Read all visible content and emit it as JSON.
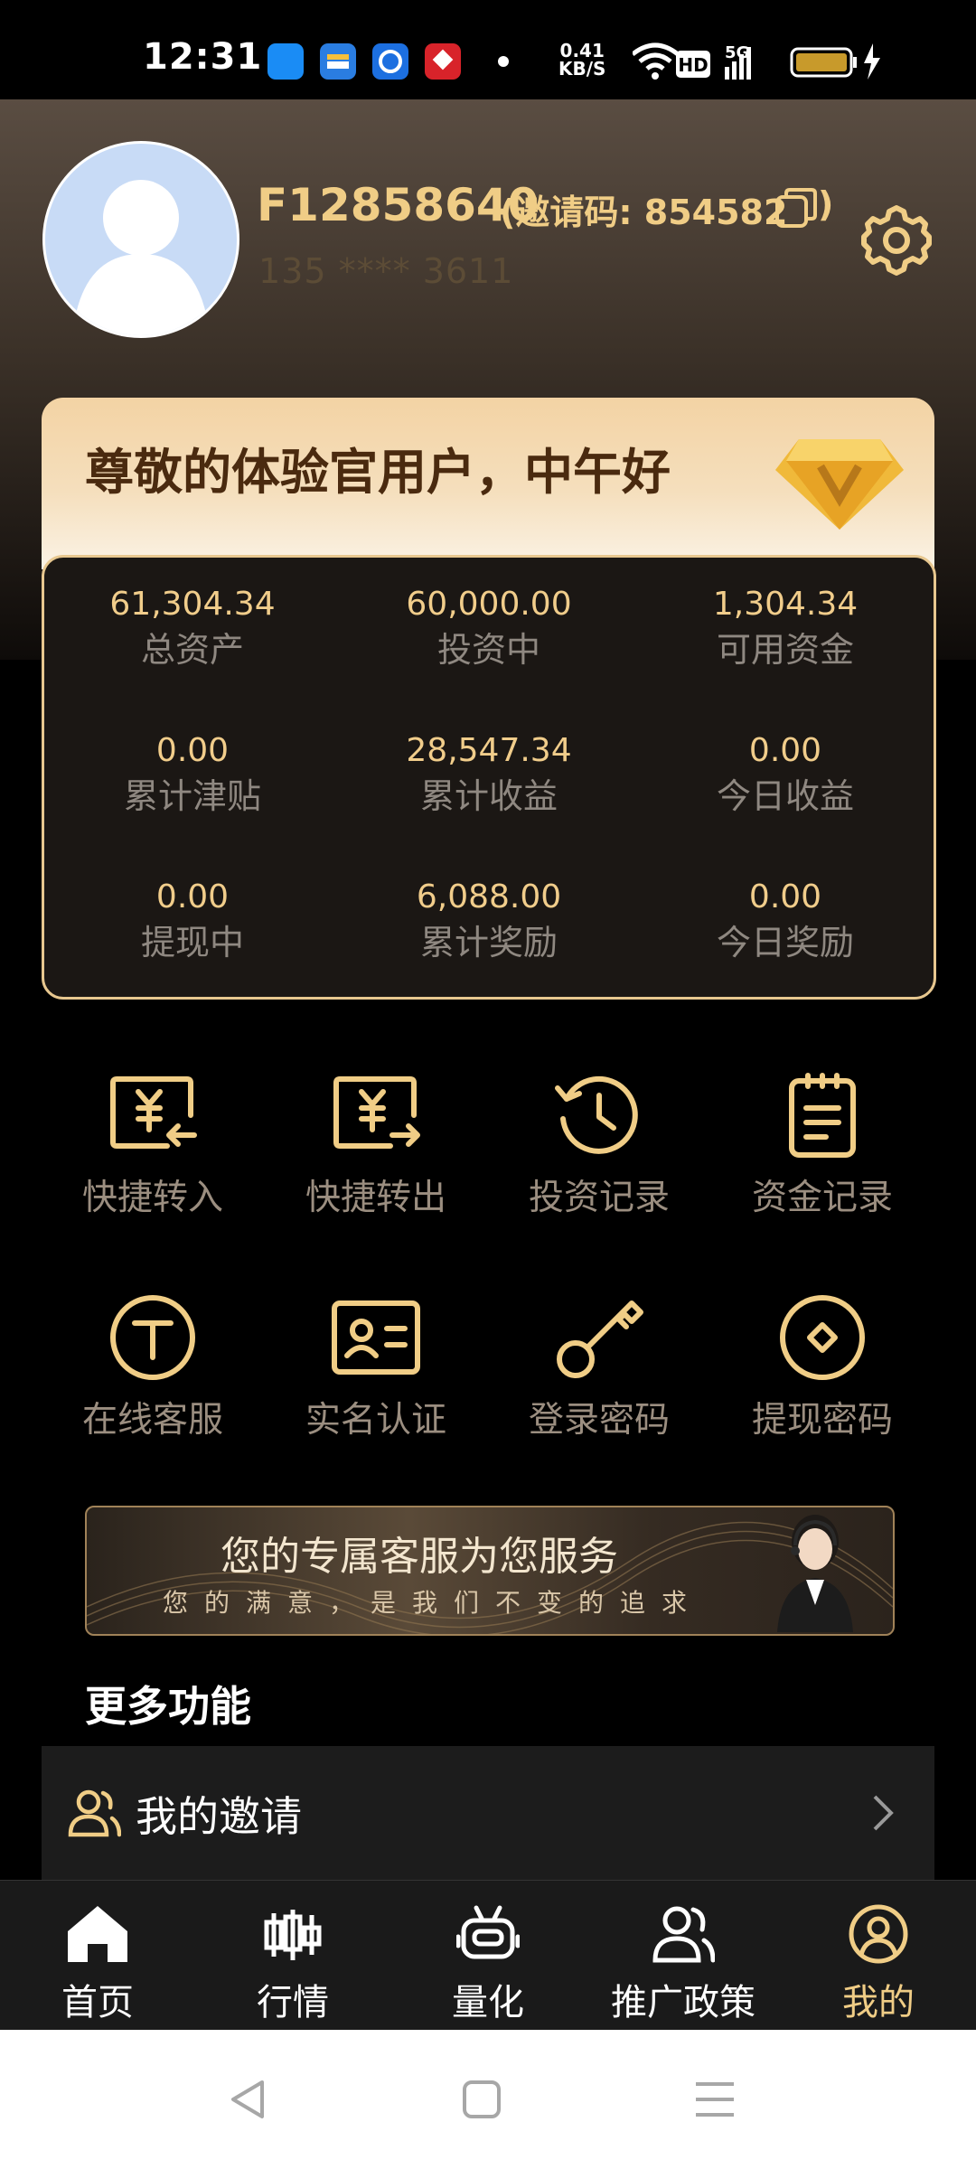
{
  "status_bar": {
    "time": "12:31",
    "net_speed_value": "0.41",
    "net_speed_unit": "KB/S",
    "hd_label": "HD",
    "signal_label": "5G"
  },
  "profile": {
    "user_id": "F12858640",
    "invite_prefix": "(邀请码: 854582",
    "invite_suffix": ")",
    "phone": "135 **** 3611"
  },
  "greeting": "尊敬的体验官用户，中午好",
  "stats": [
    {
      "value": "61,304.34",
      "label": "总资产"
    },
    {
      "value": "60,000.00",
      "label": "投资中"
    },
    {
      "value": "1,304.34",
      "label": "可用资金"
    },
    {
      "value": "0.00",
      "label": "累计津贴"
    },
    {
      "value": "28,547.34",
      "label": "累计收益"
    },
    {
      "value": "0.00",
      "label": "今日收益"
    },
    {
      "value": "0.00",
      "label": "提现中"
    },
    {
      "value": "6,088.00",
      "label": "累计奖励"
    },
    {
      "value": "0.00",
      "label": "今日奖励"
    }
  ],
  "actions": [
    {
      "label": "快捷转入",
      "icon": "yuan-transfer-in-icon"
    },
    {
      "label": "快捷转出",
      "icon": "yuan-transfer-out-icon"
    },
    {
      "label": "投资记录",
      "icon": "history-clock-icon"
    },
    {
      "label": "资金记录",
      "icon": "clipboard-icon"
    },
    {
      "label": "在线客服",
      "icon": "customer-service-icon"
    },
    {
      "label": "实名认证",
      "icon": "id-card-icon"
    },
    {
      "label": "登录密码",
      "icon": "key-icon"
    },
    {
      "label": "提现密码",
      "icon": "diamond-lock-icon"
    }
  ],
  "banner": {
    "title": "您的专属客服为您服务",
    "subtitle": "您的满意，是我们不变的追求"
  },
  "more": {
    "title": "更多功能",
    "items": [
      {
        "label": "我的邀请",
        "icon": "users-icon"
      }
    ]
  },
  "tabs": [
    {
      "label": "首页",
      "icon": "home-icon"
    },
    {
      "label": "行情",
      "icon": "candlestick-icon"
    },
    {
      "label": "量化",
      "icon": "robot-icon"
    },
    {
      "label": "推广政策",
      "icon": "users-icon"
    },
    {
      "label": "我的",
      "icon": "user-circle-icon",
      "active": true
    }
  ],
  "colors": {
    "accent": "#f0cd86",
    "background": "#000000"
  }
}
